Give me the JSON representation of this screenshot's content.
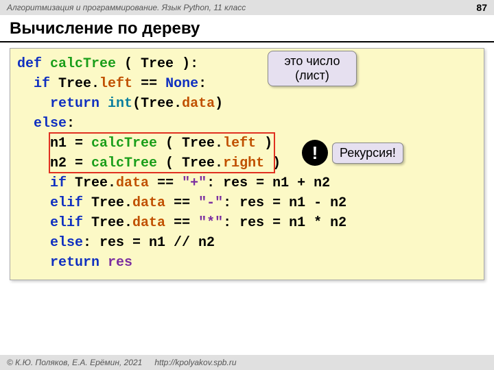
{
  "header": {
    "course": "Алгоритмизация и программирование. Язык Python, 11 класс",
    "page": "87"
  },
  "title": "Вычисление по дереву",
  "code": {
    "l1": {
      "def": "def",
      "name": "calcTree",
      "rest": " ( Tree ):"
    },
    "l2": {
      "if": "if",
      "tree": " Tree.",
      "attr": "left",
      "eq": " == ",
      "none": "None",
      "colon": ":"
    },
    "l3": {
      "ret": "return",
      "sp": " ",
      "int": "int",
      "op": "(",
      "tree": "Tree.",
      "attr": "data",
      "cp": ")"
    },
    "l4": {
      "else": "else",
      "colon": ":"
    },
    "l5": {
      "n1": "n1 = ",
      "fn": "calcTree",
      "arg": " ( Tree.",
      "attr": "left",
      "end": " )"
    },
    "l6": {
      "n2": "n2 = ",
      "fn": "calcTree",
      "arg": " ( Tree.",
      "attr": "right",
      "end": " )"
    },
    "l7": {
      "if": "if",
      "tree": " Tree.",
      "attr": "data",
      "eq": " == ",
      "str": "\"+\"",
      "rest": ":   res = n1 + n2"
    },
    "l8": {
      "elif": "elif",
      "tree": " Tree.",
      "attr": "data",
      "eq": " == ",
      "str": "\"-\"",
      "rest": ": res = n1 - n2"
    },
    "l9": {
      "elif": "elif",
      "tree": " Tree.",
      "attr": "data",
      "eq": " == ",
      "str": "\"*\"",
      "rest": ": res = n1 * n2"
    },
    "l10": {
      "else": "else",
      "rest": ": res = n1 // n2"
    },
    "l11": {
      "ret": "return",
      "res": " res"
    }
  },
  "callouts": {
    "leaf": "это число\n(лист)",
    "leaf_l1": "это число",
    "leaf_l2": "(лист)",
    "recursion": "Рекурсия!",
    "excl": "!"
  },
  "footer": {
    "copyright": "© К.Ю. Поляков, Е.А. Ерёмин, 2021",
    "url": "http://kpolyakov.spb.ru"
  }
}
